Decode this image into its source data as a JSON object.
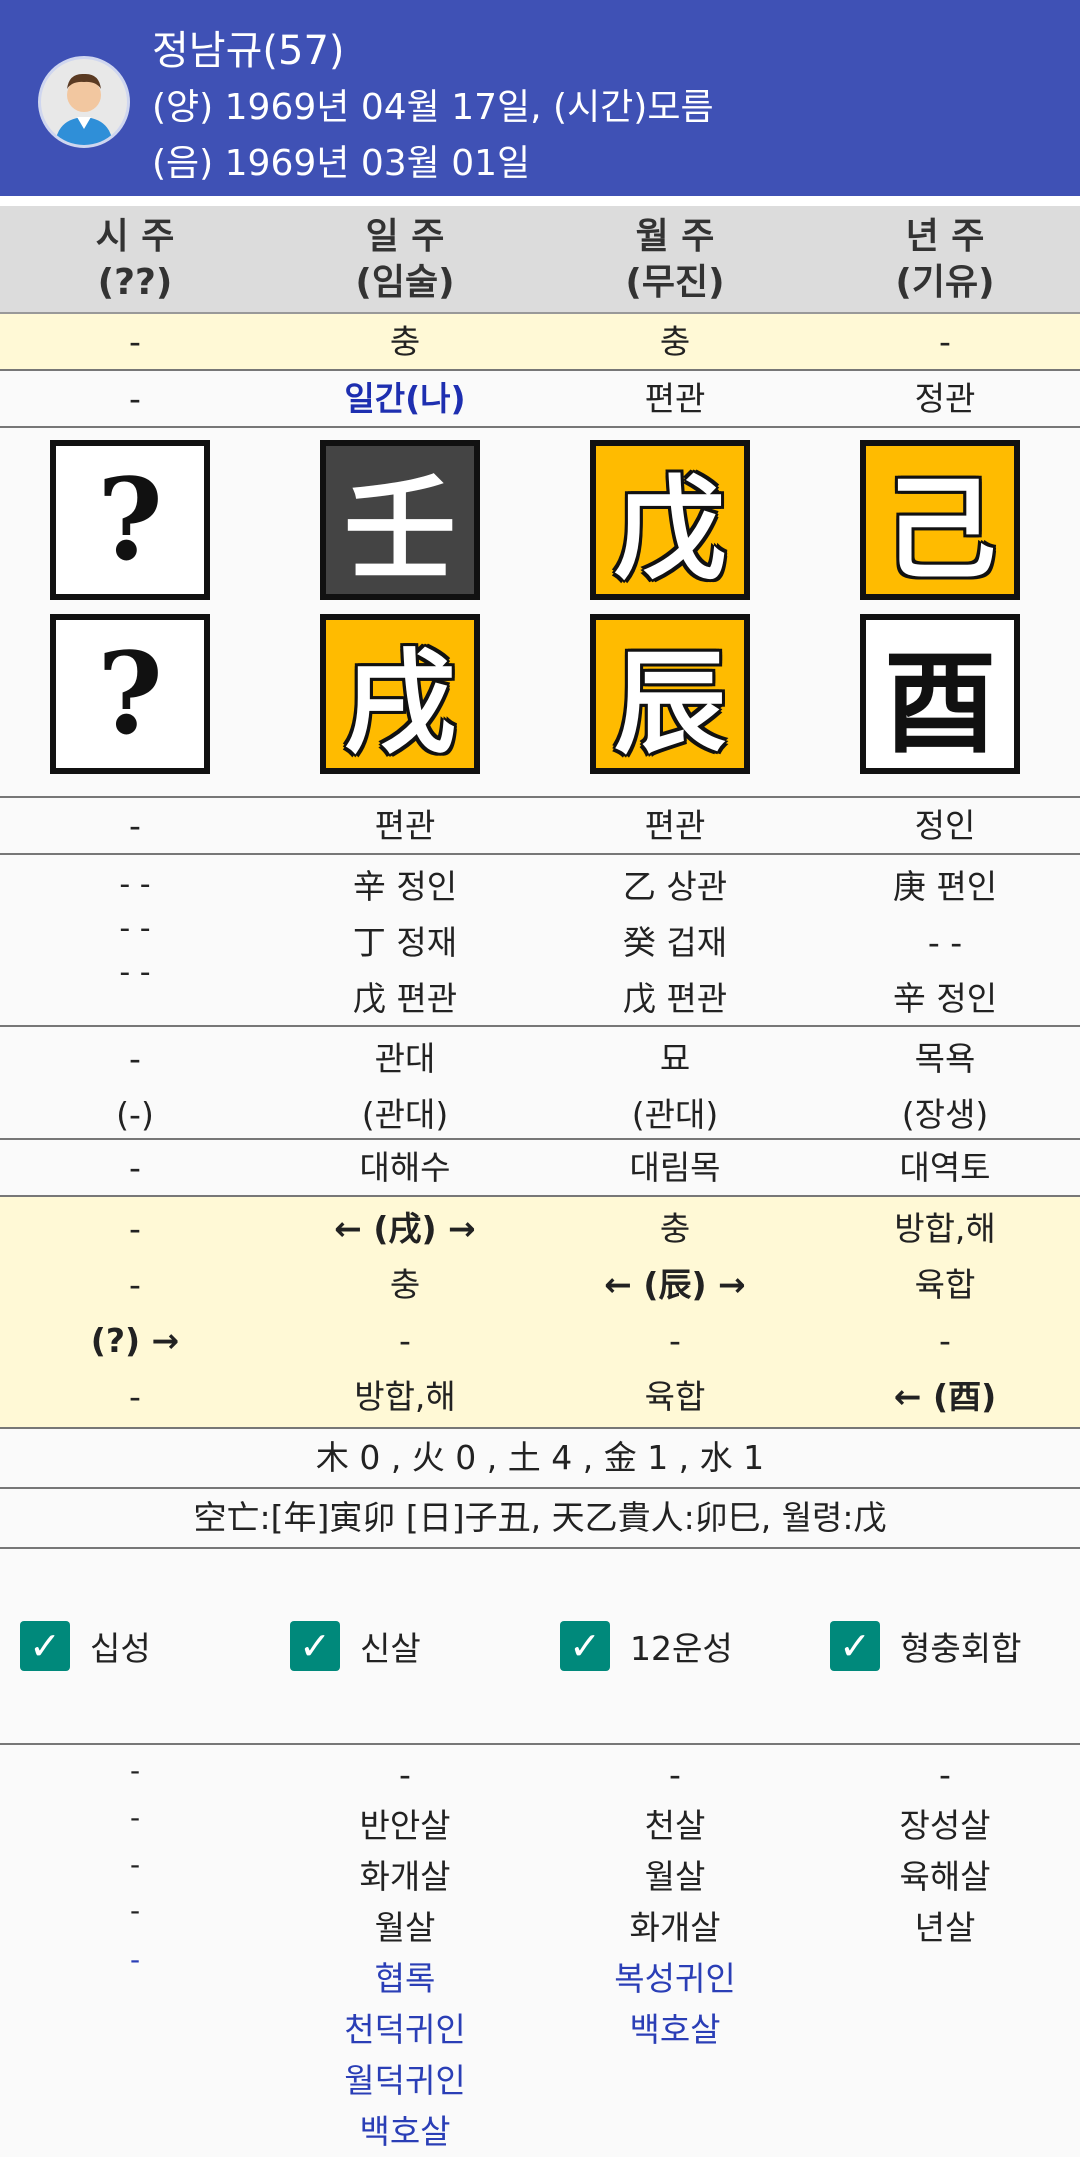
{
  "header": {
    "name": "정남규(57)",
    "solar": "(양) 1969년 04월 17일, (시간)모름",
    "lunar": "(음) 1969년 03월 01일"
  },
  "columns": [
    {
      "title": "시 주",
      "sub": "(??)"
    },
    {
      "title": "일 주",
      "sub": "(임술)"
    },
    {
      "title": "월 주",
      "sub": "(무진)"
    },
    {
      "title": "년 주",
      "sub": "(기유)"
    }
  ],
  "chung_row": [
    "-",
    "충",
    "충",
    "-"
  ],
  "sipsung_top": [
    "-",
    "일간(나)",
    "편관",
    "정관"
  ],
  "stems": [
    "?",
    "壬",
    "戊",
    "己"
  ],
  "branches": [
    "?",
    "戌",
    "辰",
    "酉"
  ],
  "sipsung_bottom": [
    "-",
    "편관",
    "편관",
    "정인"
  ],
  "jijanggan": [
    [
      "- -",
      "- -",
      "- -"
    ],
    [
      "辛 정인",
      "丁 정재",
      "戊 편관"
    ],
    [
      "乙 상관",
      "癸 겁재",
      "戊 편관"
    ],
    [
      "庚 편인",
      "- -",
      "辛 정인"
    ]
  ],
  "unsung": [
    [
      "-",
      "(-)"
    ],
    [
      "관대",
      "(관대)"
    ],
    [
      "묘",
      "(관대)"
    ],
    [
      "목욕",
      "(장생)"
    ]
  ],
  "napeum": [
    "-",
    "대해수",
    "대림목",
    "대역토"
  ],
  "relations": [
    [
      "-",
      "-",
      "(?) →",
      "-"
    ],
    [
      "← (戌) →",
      "충",
      "-",
      "방합,해"
    ],
    [
      "충",
      "← (辰) →",
      "-",
      "육합"
    ],
    [
      "방합,해",
      "육합",
      "-",
      "← (酉)"
    ]
  ],
  "five_elements": "木 0 , 火 0 , 土 4 , 金 1 , 水 1",
  "gongmang": "空亡:[年]寅卯 [日]子丑, 天乙貴人:卯巳, 월령:戊",
  "checkboxes": [
    {
      "label": "십성",
      "checked": true
    },
    {
      "label": "신살",
      "checked": true
    },
    {
      "label": "12운성",
      "checked": true
    },
    {
      "label": "형충회합",
      "checked": true
    }
  ],
  "sinsal": [
    {
      "black": [
        "-",
        "-",
        "-",
        "-"
      ],
      "blue": [
        "-"
      ]
    },
    {
      "black": [
        "-",
        "반안살",
        "화개살",
        "월살"
      ],
      "blue": [
        "협록",
        "천덕귀인",
        "월덕귀인",
        "백호살"
      ]
    },
    {
      "black": [
        "-",
        "천살",
        "월살",
        "화개살"
      ],
      "blue": [
        "복성귀인",
        "백호살"
      ]
    },
    {
      "black": [
        "-",
        "장성살",
        "육해살",
        "년살"
      ],
      "blue": []
    }
  ],
  "colors": {
    "header": "#3f51b5",
    "yellow_row": "#fff9d6",
    "tile_gold": "#ffbb00",
    "tile_dark": "#444444",
    "checkbox": "#00897b",
    "blue_text": "#1e2fb0"
  }
}
